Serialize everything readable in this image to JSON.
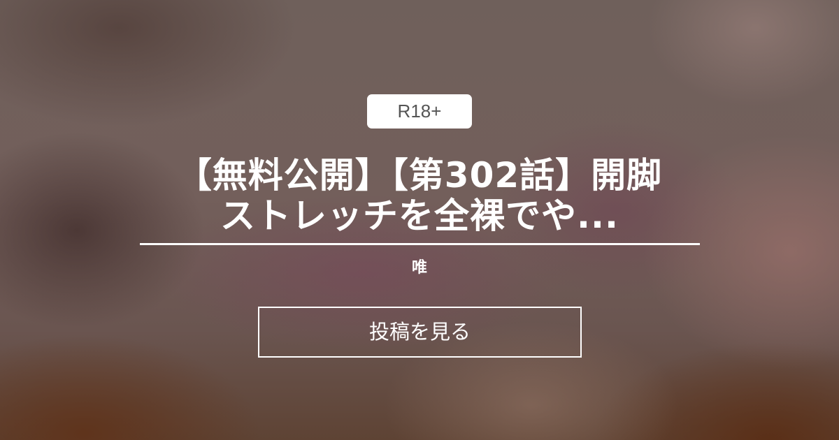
{
  "card": {
    "badge": "R18+",
    "title": "【無料公開】【第302話】開脚\nストレッチを全裸でや...",
    "author": "唯",
    "button_label": "投稿を見る"
  }
}
